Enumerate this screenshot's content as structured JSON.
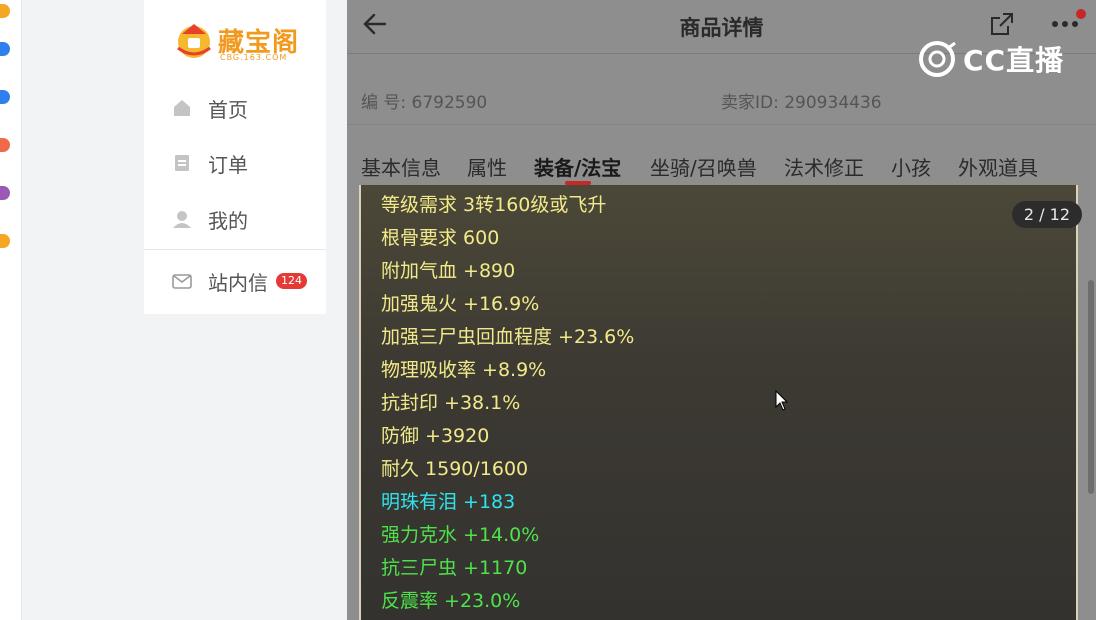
{
  "sidebar": {
    "logo_text": "藏宝阁",
    "logo_sub": "CBG.163.COM",
    "items": [
      {
        "label": "首页"
      },
      {
        "label": "订单"
      },
      {
        "label": "我的"
      },
      {
        "label": "站内信",
        "badge": "124"
      }
    ]
  },
  "header": {
    "title": "商品详情"
  },
  "watermark": "CC直播",
  "info": {
    "serial": "编 号:  6792590",
    "seller": "卖家ID:  290934436"
  },
  "tabs": [
    {
      "label": "基本信息"
    },
    {
      "label": "属性"
    },
    {
      "label": "装备/法宝",
      "active": true
    },
    {
      "label": "坐骑/召唤兽"
    },
    {
      "label": "法术修正"
    },
    {
      "label": "小孩"
    },
    {
      "label": "外观道具"
    }
  ],
  "pager": "2 / 12",
  "attributes": [
    {
      "text": "等级需求 3转160级或飞升",
      "color": "yellow"
    },
    {
      "text": "根骨要求 600",
      "color": "yellow"
    },
    {
      "text": "附加气血 +890",
      "color": "yellow"
    },
    {
      "text": "加强鬼火 +16.9%",
      "color": "yellow"
    },
    {
      "text": "加强三尸虫回血程度 +23.6%",
      "color": "yellow"
    },
    {
      "text": "物理吸收率 +8.9%",
      "color": "yellow"
    },
    {
      "text": "抗封印 +38.1%",
      "color": "yellow"
    },
    {
      "text": "防御 +3920",
      "color": "yellow"
    },
    {
      "text": "耐久 1590/1600",
      "color": "yellow"
    },
    {
      "text": "明珠有泪 +183",
      "color": "cyan"
    },
    {
      "text": "强力克水 +14.0%",
      "color": "green"
    },
    {
      "text": "抗三尸虫 +1170",
      "color": "green"
    },
    {
      "text": "反震率 +23.0%",
      "color": "green"
    }
  ],
  "colors": {
    "accent": "#c62828",
    "logo": "#f29a1e",
    "attr_yellow": "#f2ea8a",
    "attr_cyan": "#2fe3ee",
    "attr_green": "#4ee34a"
  }
}
